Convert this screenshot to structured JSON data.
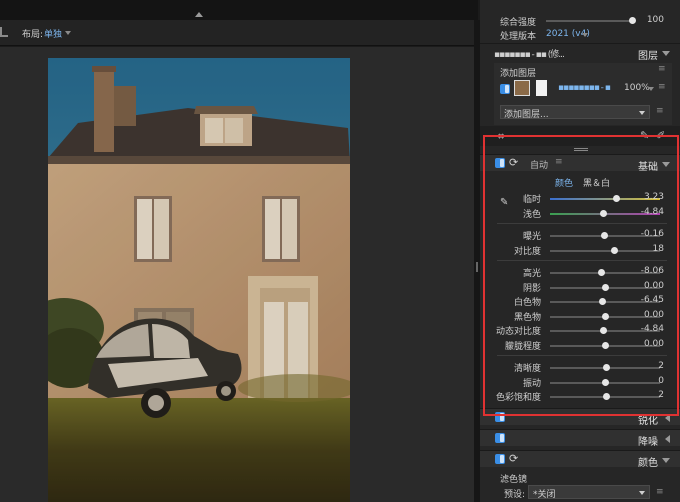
{
  "toolbar": {
    "layout_label": "布局:",
    "layout_value": "单独"
  },
  "top_settings": {
    "amount_label": "综合强度",
    "amount_value": "100",
    "amount_fraction": 1.0,
    "process_label": "处理版本",
    "process_value": "2021 (v4)"
  },
  "layers": {
    "preset_text": "▪▪▪▪▪▪▪ - ▪▪ (修...",
    "title": "图层",
    "add_layer_label": "添加图层",
    "layer_name": "▪▪▪▪▪▪▪▪ - ▪",
    "opacity": "100%",
    "add_layer_dropdown": "添加图层..."
  },
  "basic": {
    "title": "基础",
    "auto_label": "自动",
    "tabs": {
      "color": "颜色",
      "bw": "黑＆白"
    },
    "groups": [
      [
        {
          "label": "临时",
          "value": "3.23",
          "pos": 0.6,
          "track": "temp"
        },
        {
          "label": "浅色",
          "value": "-4.84",
          "pos": 0.48,
          "track": "tint"
        }
      ],
      [
        {
          "label": "曝光",
          "value": "-0.16",
          "pos": 0.49,
          "track": "plain"
        },
        {
          "label": "对比度",
          "value": "18",
          "pos": 0.58,
          "track": "plain"
        }
      ],
      [
        {
          "label": "高光",
          "value": "-8.06",
          "pos": 0.46,
          "track": "plain"
        },
        {
          "label": "阴影",
          "value": "0.00",
          "pos": 0.5,
          "track": "plain"
        },
        {
          "label": "白色物",
          "value": "-6.45",
          "pos": 0.47,
          "track": "plain"
        },
        {
          "label": "黑色物",
          "value": "0.00",
          "pos": 0.5,
          "track": "plain"
        },
        {
          "label": "动态对比度",
          "value": "-4.84",
          "pos": 0.48,
          "track": "plain"
        },
        {
          "label": "朦胧程度",
          "value": "0.00",
          "pos": 0.5,
          "track": "plain"
        }
      ],
      [
        {
          "label": "清晰度",
          "value": "2",
          "pos": 0.51,
          "track": "plain"
        },
        {
          "label": "振动",
          "value": "0",
          "pos": 0.5,
          "track": "plain"
        },
        {
          "label": "色彩饱和度",
          "value": "2",
          "pos": 0.51,
          "track": "plain"
        }
      ]
    ]
  },
  "sections": {
    "sharpen": "锐化",
    "noise": "降噪",
    "color": "颜色"
  },
  "color_section": {
    "filter_label": "滤色镜",
    "preset_label": "预设:",
    "preset_value": "*关闭"
  },
  "colors": {
    "accent": "#3a8ee6",
    "highlight_box": "#e03232"
  }
}
